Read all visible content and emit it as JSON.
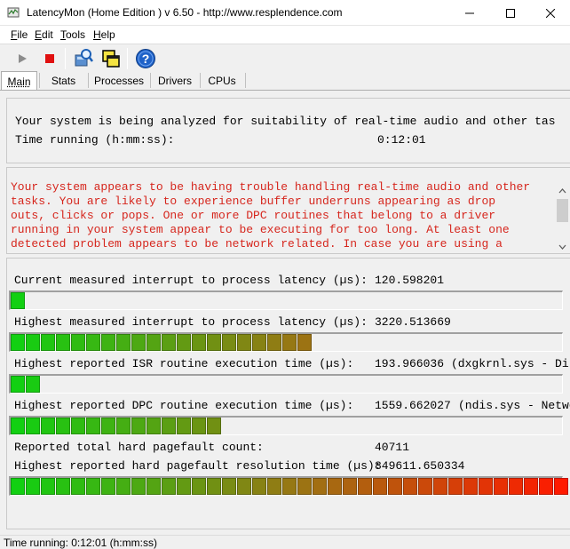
{
  "window": {
    "title": "LatencyMon  (Home Edition )  v 6.50 - http://www.resplendence.com"
  },
  "menu": [
    {
      "label": "File",
      "accel": "F",
      "rest": "ile"
    },
    {
      "label": "Edit",
      "accel": "E",
      "rest": "dit"
    },
    {
      "label": "Tools",
      "accel": "T",
      "rest": "ools"
    },
    {
      "label": "Help",
      "accel": "H",
      "rest": "elp"
    }
  ],
  "toolbar": {
    "start": "play-icon",
    "stop": "stop-icon",
    "drivers": "driver-search-icon",
    "windows": "windows-icon",
    "help": "help-icon"
  },
  "tabs": [
    "Main",
    "Stats",
    "Processes",
    "Drivers",
    "CPUs"
  ],
  "summary": {
    "line1": "Your system is being analyzed for suitability of real-time audio and other tas",
    "time_label": "Time running (h:mm:ss):",
    "time_value": "0:12:01"
  },
  "conclusion": {
    "text": "Your system appears to be having trouble handling real-time audio and other\ntasks. You are likely to experience buffer underruns appearing as drop\nouts, clicks or pops. One or more DPC routines that belong to a driver\nrunning in your system appear to be executing for too long. At least one\ndetected problem appears to be network related. In case you are using a"
  },
  "stats": [
    {
      "label": "Current measured interrupt to process latency (µs):",
      "value": "120.598201",
      "extra": "",
      "bar_segments": 1
    },
    {
      "label": "Highest measured interrupt to process latency (µs):",
      "value": "3220.513669",
      "extra": "",
      "bar_segments": 20
    },
    {
      "label": "Highest reported ISR routine execution time (µs):",
      "value": "193.966036",
      "extra": "(dxgkrnl.sys - Dire",
      "bar_segments": 2
    },
    {
      "label": "Highest reported DPC routine execution time (µs):",
      "value": "1559.662027",
      "extra": "(ndis.sys - Networ",
      "bar_segments": 14
    },
    {
      "label": "Reported total hard pagefault count:",
      "value": "40711",
      "extra": ""
    },
    {
      "label": "Highest reported hard pagefault resolution time (µs):",
      "value": "849611.650334",
      "extra": "",
      "bar_segments": 37
    }
  ],
  "colors": {
    "red_text": "#d6261d",
    "bar_start": "#12d012",
    "bar_end": "#ff1a00"
  },
  "status": {
    "text": "Time running: 0:12:01  (h:mm:ss)"
  }
}
